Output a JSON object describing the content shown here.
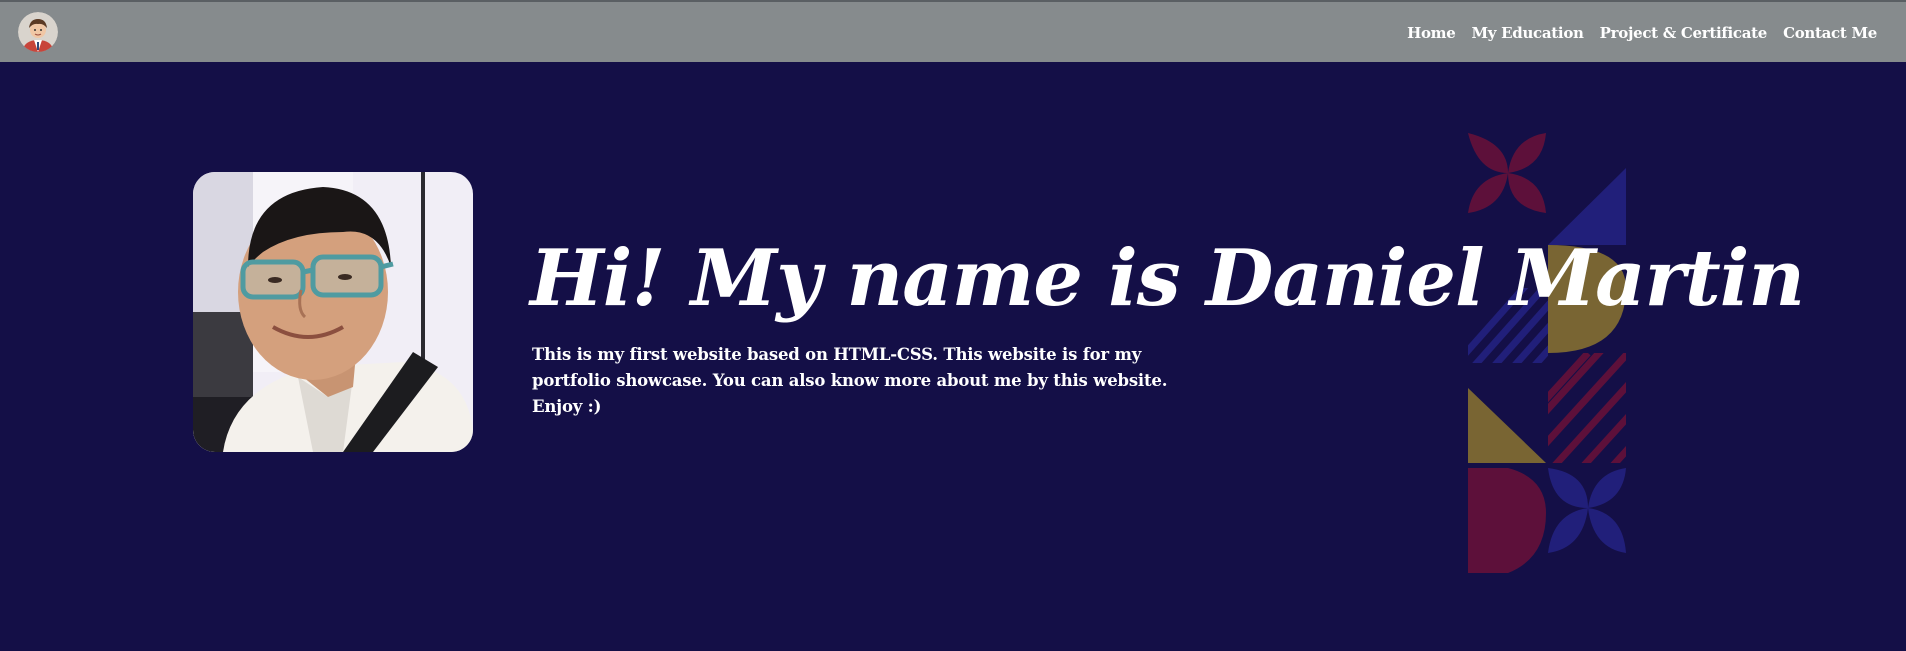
{
  "nav": {
    "logo_icon": "avatar-cartoon-icon",
    "links": [
      "Home",
      "My Education",
      "Project & Certificate",
      "Contact Me"
    ]
  },
  "hero": {
    "title": "Hi! My name is Daniel Martin",
    "description": "This is my first website based on HTML-CSS. This website is for my portfolio showcase. You can also know more about me by this website. Enjoy :)",
    "photo": "profile-photo"
  },
  "colors": {
    "background": "#140f47",
    "navbar": "#868b8d",
    "text": "#ffffff",
    "pattern_red": "#8a1233",
    "pattern_blue": "#2a2a9a",
    "pattern_gold": "#b89a28"
  }
}
